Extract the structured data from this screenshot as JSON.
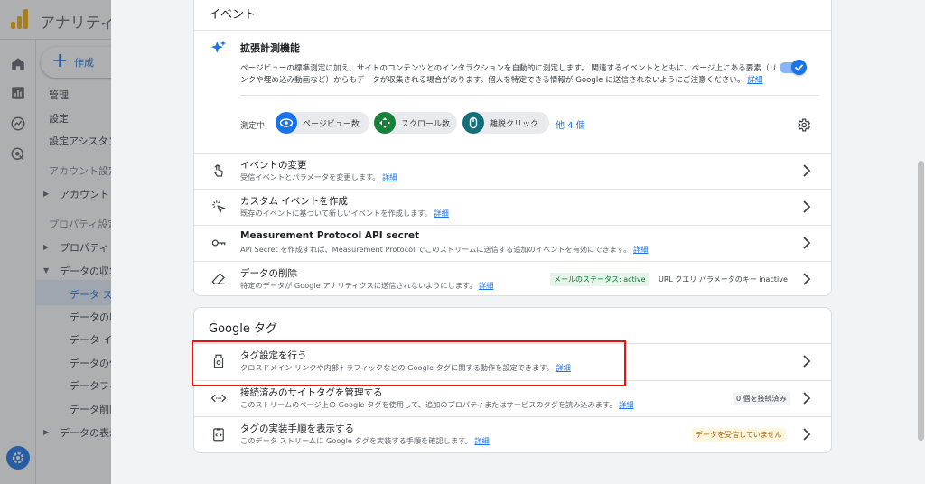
{
  "app": {
    "title": "アナリティ"
  },
  "nav": {
    "create_label": "作成",
    "items": {
      "admin": "管理",
      "settings": "設定",
      "settings_assistant": "設定アシスタン",
      "account_settings": "アカウント設定",
      "account": "アカウント",
      "property_settings": "プロパティ設定",
      "property": "プロパティ",
      "data_collection": "データの収集",
      "data_streams": "データ スト",
      "data_collection_2": "データの収",
      "data_import": "データ イン",
      "data_retention": "データの保",
      "data_filters": "データフィ",
      "data_deletion": "データ削除",
      "data_display": "データの表示"
    }
  },
  "events": {
    "header": "イベント",
    "enhanced": {
      "title": "拡張計測機能",
      "desc": "ページビューの標準測定に加え、サイトのコンテンツとのインタラクションを自動的に測定します。 関連するイベントとともに、ページ上にある要素（リンクや埋め込み動画など）からもデータが収集される場合があります。個人を特定できる情報が Google に送信されないようにご注意ください。",
      "desc_link": "詳細",
      "toggle_state": "on",
      "measuring_label": "測定中:",
      "chips": {
        "pageview": "ページビュー数",
        "scroll": "スクロール数",
        "outbound": "離脱クリック"
      },
      "more": "他 4 個"
    },
    "rows": {
      "modify": {
        "title": "イベントの変更",
        "sub": "受信イベントとパラメータを変更します。",
        "link": "詳細"
      },
      "custom": {
        "title": "カスタム イベントを作成",
        "sub": "既存のイベントに基づいて新しいイベントを作成します。",
        "link": "詳細"
      },
      "mp": {
        "title": "Measurement Protocol API secret",
        "sub": "API Secret を作成すれば、Measurement Protocol でこのストリームに送信する追加のイベントを有効にできます。",
        "link": "詳細"
      },
      "deletion": {
        "title": "データの削除",
        "sub": "特定のデータが Google アナリティクスに送信されないようにします。",
        "link": "詳細",
        "badge_email": "メールのステータス: active",
        "badge_url": "URL クエリ パラメータのキー inactive"
      }
    }
  },
  "gtag": {
    "header": "Google タグ",
    "rows": {
      "configure": {
        "title": "タグ設定を行う",
        "sub": "クロスドメイン リンクや内部トラフィックなどの Google タグに関する動作を設定できます。",
        "link": "詳細"
      },
      "connected": {
        "title": "接続済みのサイトタグを管理する",
        "sub": "このストリームのページ上の Google タグを使用して、追加のプロパティまたはサービスのタグを読み込みます。",
        "link": "詳細",
        "badge": "0 個を接続済み"
      },
      "instructions": {
        "title": "タグの実装手順を表示する",
        "sub": "このデータ ストリームに Google タグを実装する手順を確認します。",
        "link": "詳細",
        "badge": "データを受信していません"
      }
    }
  },
  "colors": {
    "accent": "#1a73e8",
    "highlight": "#e8140c"
  }
}
